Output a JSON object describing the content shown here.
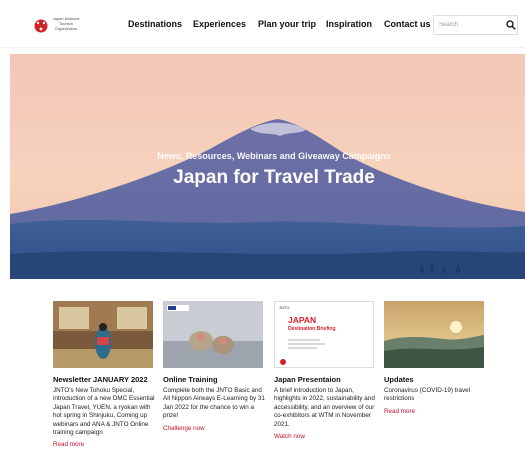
{
  "header": {
    "logo_text": "Japan National Tourism Organization",
    "nav": [
      "Destinations",
      "Experiences",
      "Plan your trip",
      "Inspiration",
      "Contact us"
    ],
    "search_placeholder": "Search"
  },
  "hero": {
    "kicker": "News, Resources, Webinars and Giveaway Campaigns",
    "title": "Japan for Travel Trade"
  },
  "cards": [
    {
      "title": "Newsletter JANUARY 2022",
      "text": "JNTO's New Tohoku Special, introduction of a new DMC Essential Japan Travel, YUEN, a ryokan with hot spring in Shinjuku, Coming up webinars and ANA & JNTO Online training campaign",
      "link": "Read more"
    },
    {
      "title": "Online Training",
      "text": "Complete both the JNTO Basic and All Nippon Airways E-Learning by 31 Jan 2022 for the chance to win a prize!",
      "link": "Challenge now"
    },
    {
      "title": "Japan Presentaion",
      "text": "A brief introduction to Japan, highlights in 2022, sustainability and accessibility, and an overview of our co-exhibitors at WTM in November 2021.",
      "link": "Watch now",
      "thumb_title": "JAPAN",
      "thumb_subtitle": "Destination Briefing",
      "thumb_logo": "JNTO"
    },
    {
      "title": "Updates",
      "text": "Coronavirus (COVID-19) travel restrictions",
      "link": "Read more"
    }
  ],
  "colors": {
    "accent": "#c8102e",
    "brand_red": "#d2232a"
  }
}
